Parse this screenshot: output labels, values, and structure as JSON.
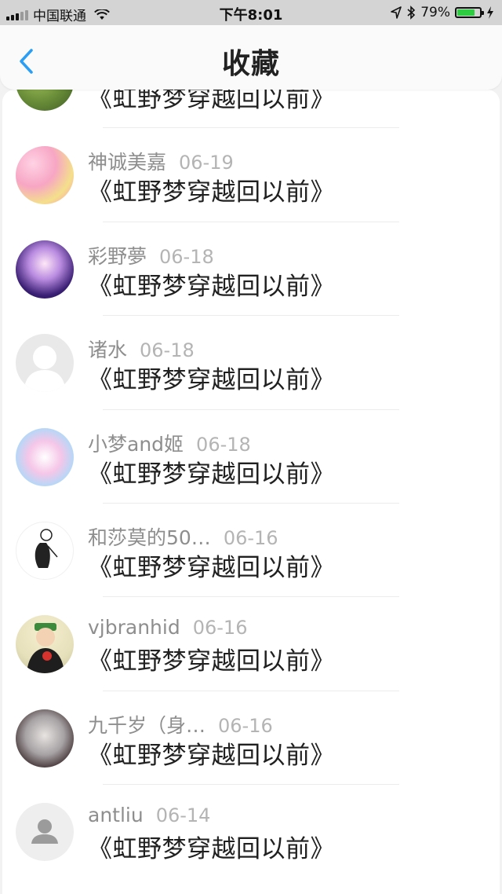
{
  "status_bar": {
    "carrier": "中国联通",
    "time": "下午8:01",
    "battery_percent": "79%",
    "battery_level": 0.79,
    "battery_color": "#2ecc40"
  },
  "nav": {
    "title": "收藏",
    "back_icon": "chevron-left-icon",
    "accent_color": "#2a9df4"
  },
  "items": [
    {
      "name": "",
      "date": "",
      "title": "《虹野梦穿越回以前》",
      "avatar": "avatar-image"
    },
    {
      "name": "神诚美嘉",
      "date": "06-19",
      "title": "《虹野梦穿越回以前》",
      "avatar": "avatar-image"
    },
    {
      "name": "彩野夢",
      "date": "06-18",
      "title": "《虹野梦穿越回以前》",
      "avatar": "avatar-image"
    },
    {
      "name": "诸水",
      "date": "06-18",
      "title": "《虹野梦穿越回以前》",
      "avatar": "default-avatar-icon"
    },
    {
      "name": "小梦and姬",
      "date": "06-18",
      "title": "《虹野梦穿越回以前》",
      "avatar": "avatar-image"
    },
    {
      "name": "和莎莫的50…",
      "date": "06-16",
      "title": "《虹野梦穿越回以前》",
      "avatar": "avatar-image"
    },
    {
      "name": "vjbranhid",
      "date": "06-16",
      "title": "《虹野梦穿越回以前》",
      "avatar": "avatar-image"
    },
    {
      "name": "九千岁（身…",
      "date": "06-16",
      "title": "《虹野梦穿越回以前》",
      "avatar": "avatar-image"
    },
    {
      "name": "antliu",
      "date": "06-14",
      "title": "《虹野梦穿越回以前》",
      "avatar": "default-user-icon"
    }
  ]
}
